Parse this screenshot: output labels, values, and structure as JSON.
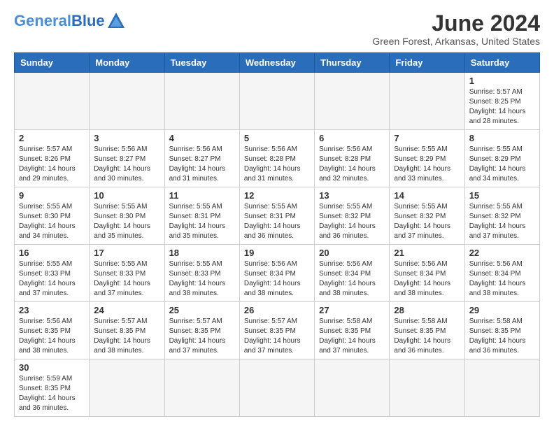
{
  "header": {
    "logo_general": "General",
    "logo_blue": "Blue",
    "month_title": "June 2024",
    "location": "Green Forest, Arkansas, United States"
  },
  "weekdays": [
    "Sunday",
    "Monday",
    "Tuesday",
    "Wednesday",
    "Thursday",
    "Friday",
    "Saturday"
  ],
  "weeks": [
    [
      {
        "day": "",
        "info": ""
      },
      {
        "day": "",
        "info": ""
      },
      {
        "day": "",
        "info": ""
      },
      {
        "day": "",
        "info": ""
      },
      {
        "day": "",
        "info": ""
      },
      {
        "day": "",
        "info": ""
      },
      {
        "day": "1",
        "info": "Sunrise: 5:57 AM\nSunset: 8:25 PM\nDaylight: 14 hours and 28 minutes."
      }
    ],
    [
      {
        "day": "2",
        "info": "Sunrise: 5:57 AM\nSunset: 8:26 PM\nDaylight: 14 hours and 29 minutes."
      },
      {
        "day": "3",
        "info": "Sunrise: 5:56 AM\nSunset: 8:27 PM\nDaylight: 14 hours and 30 minutes."
      },
      {
        "day": "4",
        "info": "Sunrise: 5:56 AM\nSunset: 8:27 PM\nDaylight: 14 hours and 31 minutes."
      },
      {
        "day": "5",
        "info": "Sunrise: 5:56 AM\nSunset: 8:28 PM\nDaylight: 14 hours and 31 minutes."
      },
      {
        "day": "6",
        "info": "Sunrise: 5:56 AM\nSunset: 8:28 PM\nDaylight: 14 hours and 32 minutes."
      },
      {
        "day": "7",
        "info": "Sunrise: 5:55 AM\nSunset: 8:29 PM\nDaylight: 14 hours and 33 minutes."
      },
      {
        "day": "8",
        "info": "Sunrise: 5:55 AM\nSunset: 8:29 PM\nDaylight: 14 hours and 34 minutes."
      }
    ],
    [
      {
        "day": "9",
        "info": "Sunrise: 5:55 AM\nSunset: 8:30 PM\nDaylight: 14 hours and 34 minutes."
      },
      {
        "day": "10",
        "info": "Sunrise: 5:55 AM\nSunset: 8:30 PM\nDaylight: 14 hours and 35 minutes."
      },
      {
        "day": "11",
        "info": "Sunrise: 5:55 AM\nSunset: 8:31 PM\nDaylight: 14 hours and 35 minutes."
      },
      {
        "day": "12",
        "info": "Sunrise: 5:55 AM\nSunset: 8:31 PM\nDaylight: 14 hours and 36 minutes."
      },
      {
        "day": "13",
        "info": "Sunrise: 5:55 AM\nSunset: 8:32 PM\nDaylight: 14 hours and 36 minutes."
      },
      {
        "day": "14",
        "info": "Sunrise: 5:55 AM\nSunset: 8:32 PM\nDaylight: 14 hours and 37 minutes."
      },
      {
        "day": "15",
        "info": "Sunrise: 5:55 AM\nSunset: 8:32 PM\nDaylight: 14 hours and 37 minutes."
      }
    ],
    [
      {
        "day": "16",
        "info": "Sunrise: 5:55 AM\nSunset: 8:33 PM\nDaylight: 14 hours and 37 minutes."
      },
      {
        "day": "17",
        "info": "Sunrise: 5:55 AM\nSunset: 8:33 PM\nDaylight: 14 hours and 37 minutes."
      },
      {
        "day": "18",
        "info": "Sunrise: 5:55 AM\nSunset: 8:33 PM\nDaylight: 14 hours and 38 minutes."
      },
      {
        "day": "19",
        "info": "Sunrise: 5:56 AM\nSunset: 8:34 PM\nDaylight: 14 hours and 38 minutes."
      },
      {
        "day": "20",
        "info": "Sunrise: 5:56 AM\nSunset: 8:34 PM\nDaylight: 14 hours and 38 minutes."
      },
      {
        "day": "21",
        "info": "Sunrise: 5:56 AM\nSunset: 8:34 PM\nDaylight: 14 hours and 38 minutes."
      },
      {
        "day": "22",
        "info": "Sunrise: 5:56 AM\nSunset: 8:34 PM\nDaylight: 14 hours and 38 minutes."
      }
    ],
    [
      {
        "day": "23",
        "info": "Sunrise: 5:56 AM\nSunset: 8:35 PM\nDaylight: 14 hours and 38 minutes."
      },
      {
        "day": "24",
        "info": "Sunrise: 5:57 AM\nSunset: 8:35 PM\nDaylight: 14 hours and 38 minutes."
      },
      {
        "day": "25",
        "info": "Sunrise: 5:57 AM\nSunset: 8:35 PM\nDaylight: 14 hours and 37 minutes."
      },
      {
        "day": "26",
        "info": "Sunrise: 5:57 AM\nSunset: 8:35 PM\nDaylight: 14 hours and 37 minutes."
      },
      {
        "day": "27",
        "info": "Sunrise: 5:58 AM\nSunset: 8:35 PM\nDaylight: 14 hours and 37 minutes."
      },
      {
        "day": "28",
        "info": "Sunrise: 5:58 AM\nSunset: 8:35 PM\nDaylight: 14 hours and 36 minutes."
      },
      {
        "day": "29",
        "info": "Sunrise: 5:58 AM\nSunset: 8:35 PM\nDaylight: 14 hours and 36 minutes."
      }
    ],
    [
      {
        "day": "30",
        "info": "Sunrise: 5:59 AM\nSunset: 8:35 PM\nDaylight: 14 hours and 36 minutes."
      },
      {
        "day": "",
        "info": ""
      },
      {
        "day": "",
        "info": ""
      },
      {
        "day": "",
        "info": ""
      },
      {
        "day": "",
        "info": ""
      },
      {
        "day": "",
        "info": ""
      },
      {
        "day": "",
        "info": ""
      }
    ]
  ]
}
